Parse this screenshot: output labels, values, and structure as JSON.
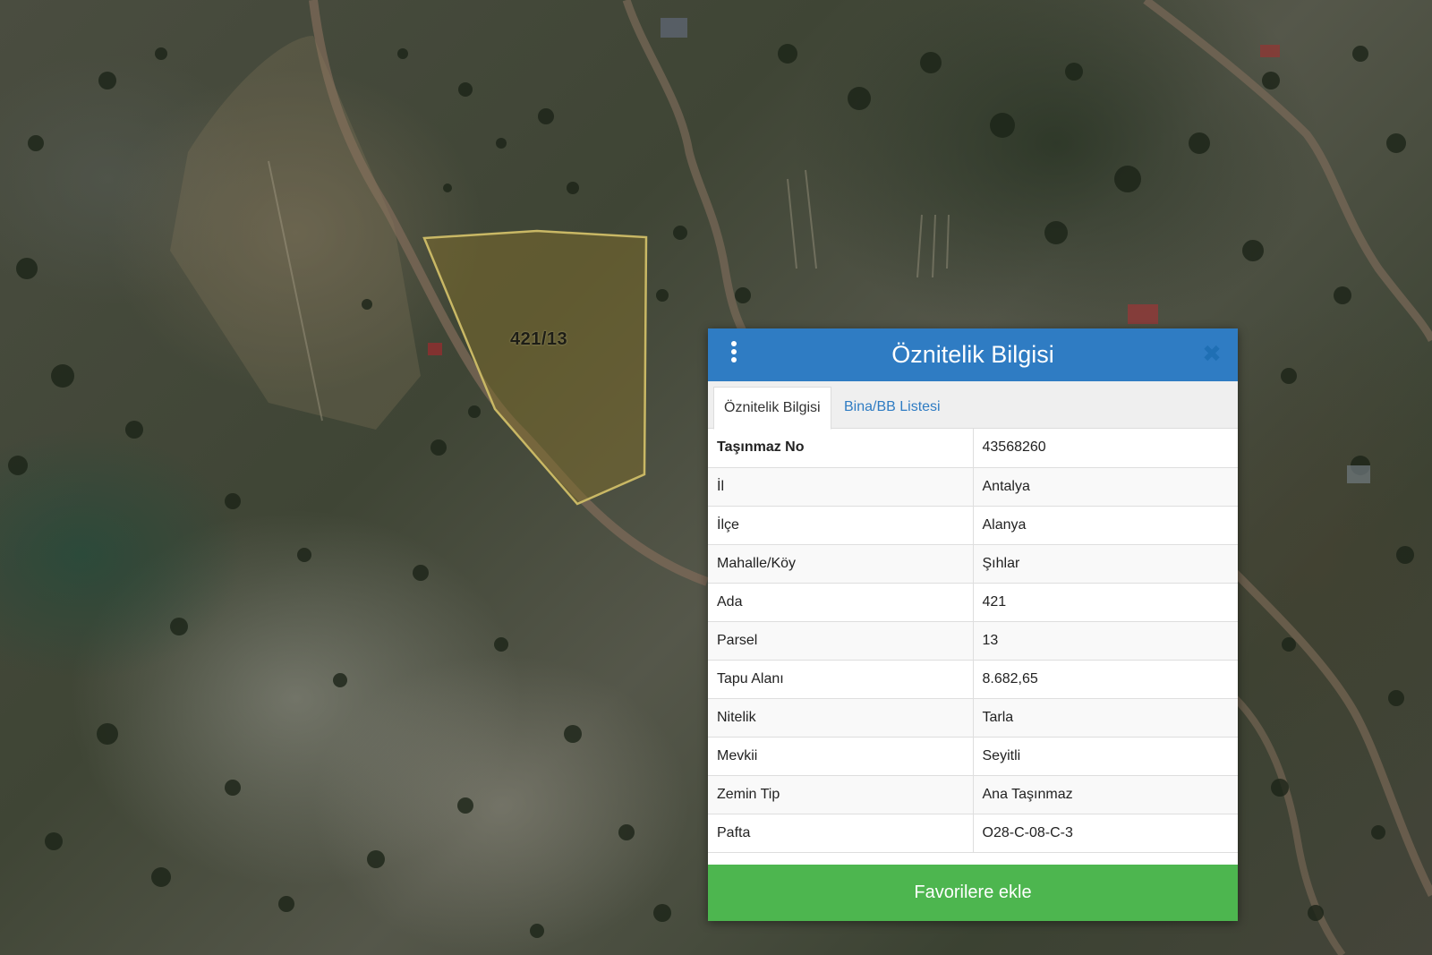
{
  "map": {
    "parcel_label": "421/13"
  },
  "panel": {
    "title": "Öznitelik Bilgisi",
    "tabs": [
      {
        "label": "Öznitelik Bilgisi",
        "active": true
      },
      {
        "label": "Bina/BB Listesi",
        "active": false
      }
    ],
    "rows": [
      {
        "key": "Taşınmaz No",
        "value": "43568260"
      },
      {
        "key": "İl",
        "value": "Antalya"
      },
      {
        "key": "İlçe",
        "value": "Alanya"
      },
      {
        "key": "Mahalle/Köy",
        "value": "Şıhlar"
      },
      {
        "key": "Ada",
        "value": "421"
      },
      {
        "key": "Parsel",
        "value": "13"
      },
      {
        "key": "Tapu Alanı",
        "value": "8.682,65"
      },
      {
        "key": "Nitelik",
        "value": "Tarla"
      },
      {
        "key": "Mevkii",
        "value": "Seyitli"
      },
      {
        "key": "Zemin Tip",
        "value": "Ana Taşınmaz"
      },
      {
        "key": "Pafta",
        "value": "O28-C-08-C-3"
      }
    ],
    "favorite_button": "Favorilere ekle"
  },
  "colors": {
    "header_blue": "#2f7cc3",
    "favorite_green": "#4db64f",
    "parcel_outline": "#c9b865"
  },
  "icons": {
    "menu": "vertical-dots-icon",
    "close": "close-x-icon"
  }
}
